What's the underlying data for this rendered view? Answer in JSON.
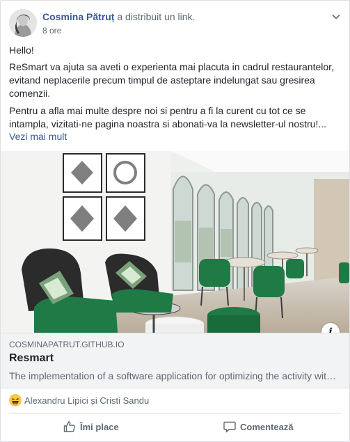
{
  "post": {
    "author": "Cosmina Pătruț",
    "action": " a distribuit un link.",
    "time": "8 ore",
    "greeting": "Hello!",
    "paragraph1": "ReSmart va ajuta sa aveti o experienta mai placuta in cadrul restaurantelor, evitand neplacerile precum timpul de asteptare indelungat sau gresirea comenzii.",
    "paragraph2": "Pentru a afla mai multe despre noi si pentru a fi la curent cu tot ce se intampla, vizitati-ne pagina noastra si abonati-va la newsletter-ul nostru!...",
    "see_more": "Vezi mai mult"
  },
  "link": {
    "domain": "COSMINAPATRUT.GITHUB.IO",
    "title": "Resmart",
    "description": "The implementation of a software application for optimizing the activity with restaurants...",
    "info_icon": "i"
  },
  "reactions": {
    "icon": "haha-emoji-icon",
    "names": "Alexandru Lipici și Cristi Sandu"
  },
  "actions": {
    "like_label": "Îmi place",
    "comment_label": "Comentează"
  },
  "colors": {
    "link_blue": "#385898",
    "text": "#1d2129",
    "muted": "#606770",
    "accent_green": "#1f7a45"
  }
}
